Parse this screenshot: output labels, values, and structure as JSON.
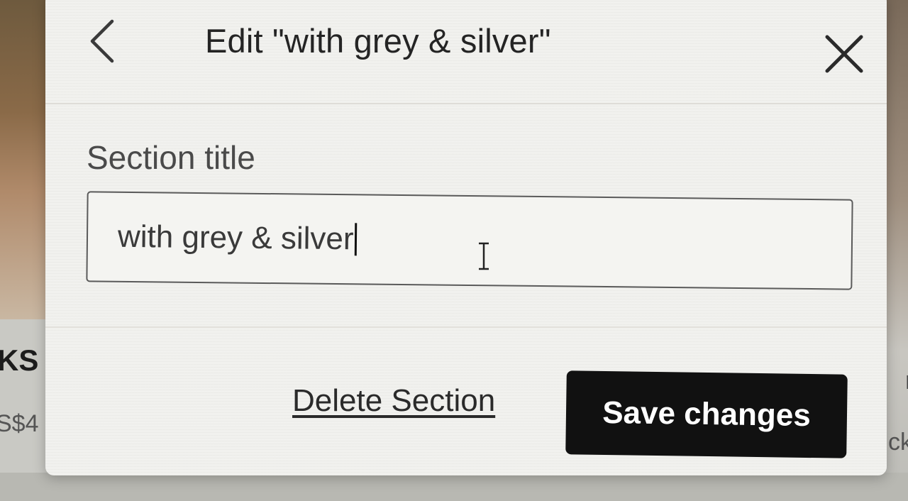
{
  "background": {
    "left_heading": "KS",
    "left_price": "S$4",
    "right_text_1": "r",
    "right_text_2": "ck"
  },
  "modal": {
    "title": "Edit \"with grey & silver\"",
    "back_icon": "chevron-left-icon",
    "close_icon": "close-icon",
    "section_label": "Section title",
    "section_value": "with grey & silver",
    "delete_label": "Delete Section",
    "save_label": "Save changes"
  },
  "colors": {
    "modal_bg": "#f1f1ee",
    "primary_button": "#111111",
    "primary_button_text": "#ffffff"
  }
}
